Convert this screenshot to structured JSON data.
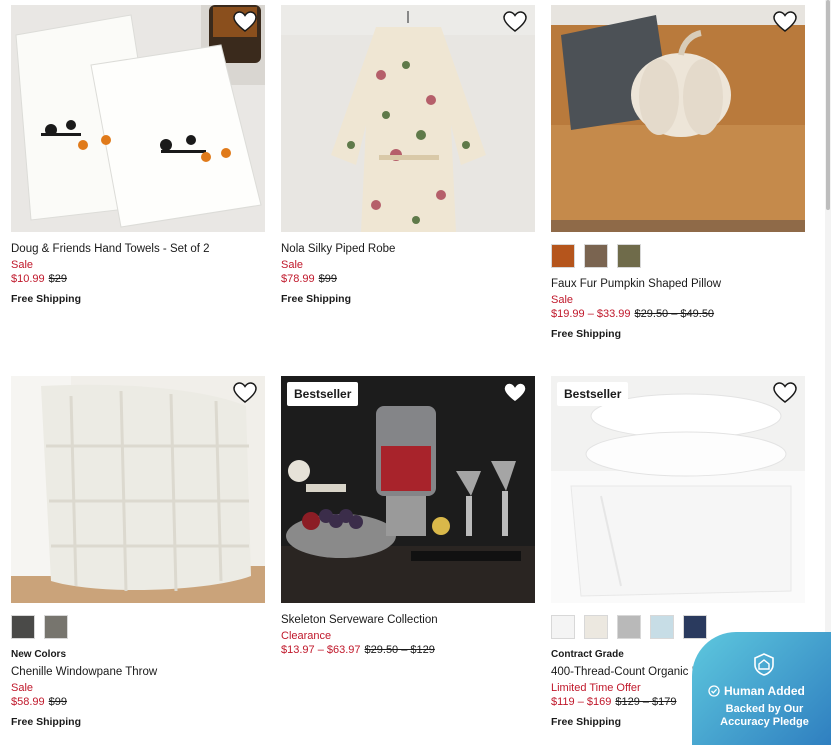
{
  "products": [
    {
      "name": "Doug & Friends Hand Towels - Set of 2",
      "promo": "Sale",
      "price_now": "$10.99",
      "price_was": "$29",
      "shipping": "Free Shipping"
    },
    {
      "name": "Nola Silky Piped Robe",
      "promo": "Sale",
      "price_now": "$78.99",
      "price_was": "$99",
      "shipping": "Free Shipping"
    },
    {
      "name": "Faux Fur Pumpkin Shaped Pillow",
      "promo": "Sale",
      "price_now": "$19.99 – $33.99",
      "price_was": "$29.50 – $49.50",
      "shipping": "Free Shipping",
      "swatches": [
        "#b5551c",
        "#7a6450",
        "#6f6b4a"
      ]
    },
    {
      "flag": "New Colors",
      "name": "Chenille Windowpane Throw",
      "promo": "Sale",
      "price_now": "$58.99",
      "price_was": "$99",
      "shipping": "Free Shipping",
      "swatches": [
        "#4a4a48",
        "#77756e"
      ]
    },
    {
      "badge": "Bestseller",
      "name": "Skeleton Serveware Collection",
      "promo": "Clearance",
      "price_now": "$13.97 – $63.97",
      "price_was": "$29.50 – $129"
    },
    {
      "badge": "Bestseller",
      "flag": "Contract Grade",
      "name": "400-Thread-Count Organic Percale Sheet Set",
      "promo": "Limited Time Offer",
      "price_now": "$119 – $169",
      "price_was": "$129 – $179",
      "shipping": "Free Shipping",
      "swatches": [
        "#f4f4f4",
        "#ece8e0",
        "#b9b9b9",
        "#c7dde6",
        "#2a3a5e"
      ]
    }
  ],
  "pledge": {
    "title": "Human Added",
    "subtitle": "Backed by Our Accuracy Pledge"
  },
  "colors": {
    "sale_red": "#c0182b",
    "pledge_blue": "#2f7fc0"
  },
  "icons": {
    "wishlist": "heart-icon",
    "pledge": "house-shield-icon",
    "check": "check-circle-icon"
  }
}
